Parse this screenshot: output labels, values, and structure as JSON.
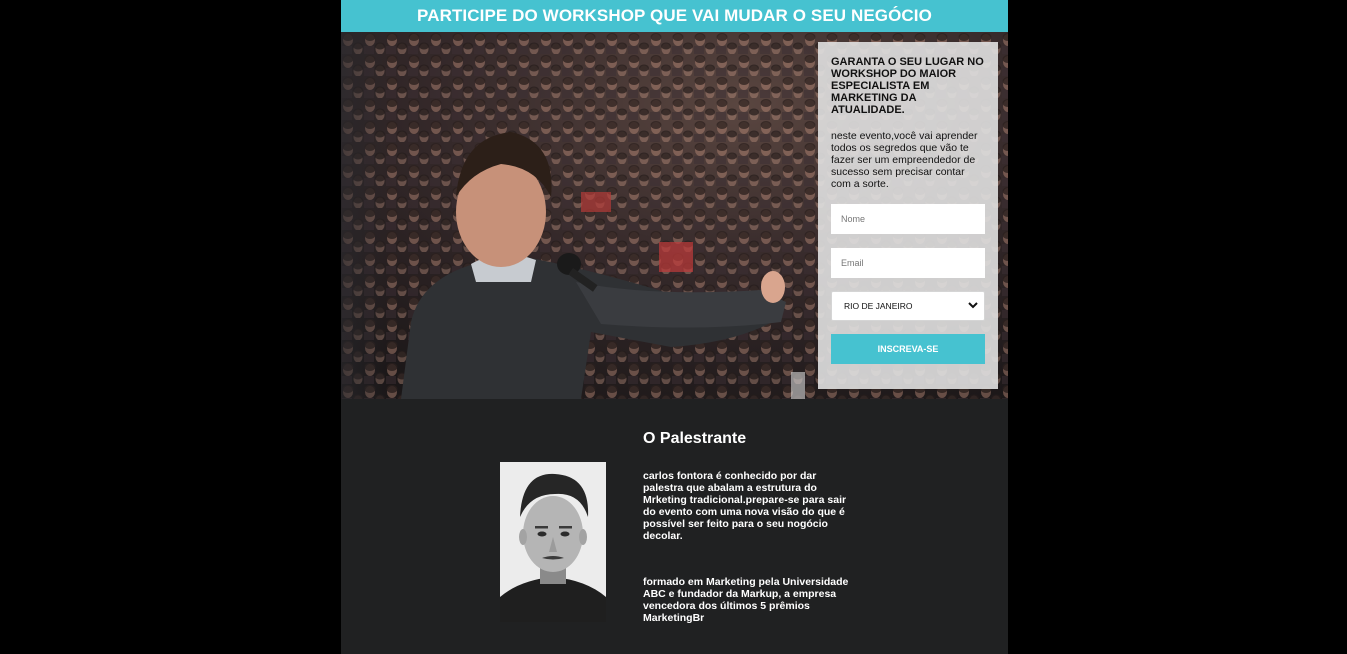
{
  "banner": {
    "title": "PARTICIPE DO WORKSHOP QUE VAI MUDAR O SEU NEGÓCIO"
  },
  "form": {
    "title": "GARANTA O SEU LUGAR NO WORKSHOP DO MAIOR ESPECIALISTA EM MARKETING DA ATUALIDADE.",
    "description": "neste evento,você vai aprender todos os segredos que vão te fazer ser um empreendedor de sucesso sem precisar contar com a sorte.",
    "name_placeholder": "Nome",
    "email_placeholder": "Email",
    "city_selected": "RIO DE JANEIRO",
    "submit_label": "INSCREVA-SE"
  },
  "speaker": {
    "title": "O Palestrante",
    "bio_1": "carlos fontora é conhecido por dar palestra que abalam a estrutura do Mrketing tradicional.prepare-se para sair do evento com uma nova visão do que é possível ser feito para o seu nogócio decolar.",
    "bio_2": "formado em Marketing pela Universidade ABC e fundador da Markup, a empresa vencedora dos últimos 5 prêmios MarketingBr"
  },
  "colors": {
    "accent": "#46c2d0",
    "page_background": "#000000",
    "section_background": "#202122"
  }
}
